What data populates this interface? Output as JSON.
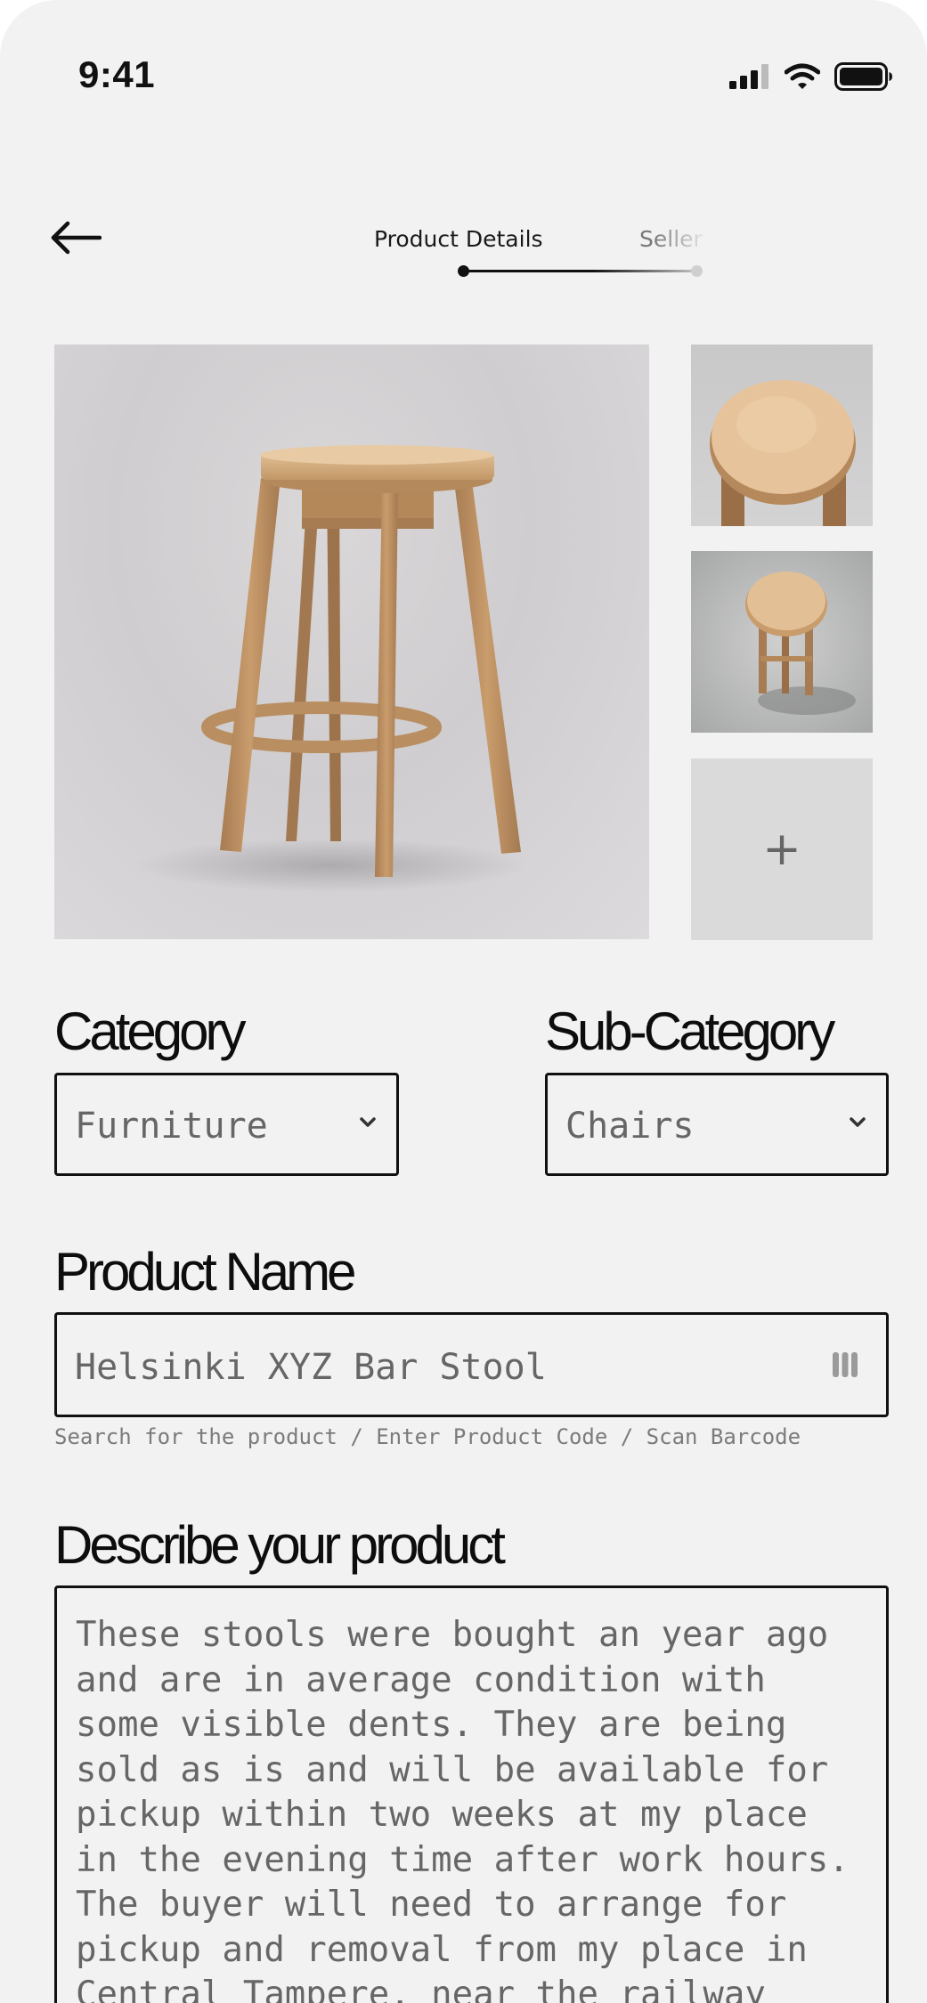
{
  "status_bar": {
    "time": "9:41",
    "icons": [
      "cellular-signal-icon",
      "wifi-icon",
      "battery-icon"
    ]
  },
  "header": {
    "back_icon": "arrow-left-icon",
    "steps": [
      {
        "label": "Product Details",
        "active": true
      },
      {
        "label": "Seller",
        "active": false
      }
    ]
  },
  "photos": {
    "main": "bar-stool-photo",
    "thumbnails": [
      "stool-seat-top-photo",
      "stool-overhead-photo"
    ],
    "add_label": "+"
  },
  "form": {
    "category": {
      "label": "Category",
      "value": "Furniture"
    },
    "sub_category": {
      "label": "Sub-Category",
      "value": "Chairs"
    },
    "product_name": {
      "label": "Product Name",
      "value": "Helsinki XYZ Bar Stool",
      "helper": "Search for the product / Enter Product Code / Scan Barcode",
      "scan_icon": "barcode-icon"
    },
    "description": {
      "label": "Describe your product",
      "value": "These stools were bought an year ago and are in average condition with some visible dents. They are being sold as is and will be available for pickup within two weeks at my place in the evening time after work hours. The buyer will need to arrange for pickup and removal from my place in Central Tampere, near the railway station. Im looking to sell the"
    }
  },
  "colors": {
    "background": "#f1f2f1",
    "text_primary": "#0d0d0d",
    "text_muted": "#666666",
    "border": "#111111",
    "wood": "#c49a6c"
  }
}
